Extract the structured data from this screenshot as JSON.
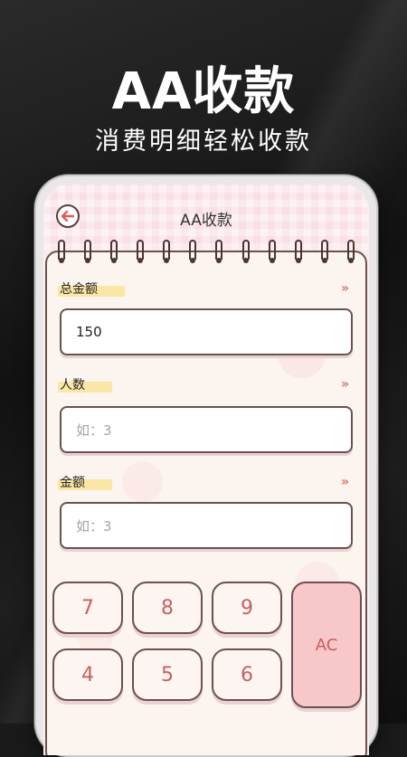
{
  "promo": {
    "title": "AA收款",
    "subtitle": "消费明细轻松收款"
  },
  "header": {
    "title": "AA收款",
    "back_icon": "back-arrow-icon"
  },
  "form": {
    "total": {
      "label": "总金额",
      "value": "150"
    },
    "people": {
      "label": "人数",
      "placeholder": "如：3"
    },
    "amount": {
      "label": "金额",
      "placeholder": "如：3"
    }
  },
  "keypad": {
    "keys": [
      "7",
      "8",
      "9",
      "4",
      "5",
      "6"
    ],
    "ac_label": "AC"
  },
  "colors": {
    "label_highlight": "#fbe7a5",
    "key_text": "#c86060",
    "ac_bg": "#f7c7c9",
    "header_bg": "#f8dfe4"
  }
}
